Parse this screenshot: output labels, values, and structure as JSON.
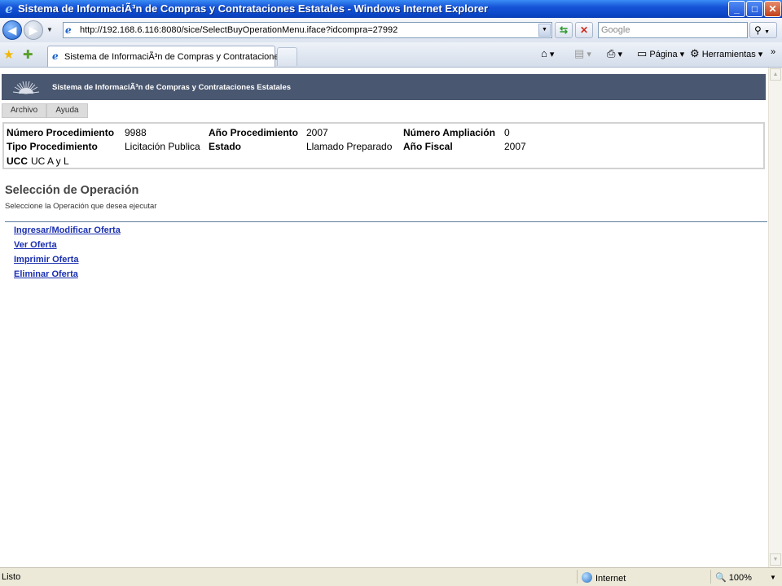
{
  "window": {
    "title": "Sistema de InformaciÃ³n de Compras y Contrataciones Estatales - Windows Internet Explorer",
    "minimize": "_",
    "maximize": "□",
    "close": "✕"
  },
  "navbar": {
    "url": "http://192.168.6.116:8080/sice/SelectBuyOperationMenu.iface?idcompra=27992",
    "search_placeholder": "Google"
  },
  "tabs": [
    {
      "label": "Sistema de InformaciÃ³n de Compras y Contratacione..."
    }
  ],
  "toolbar": {
    "page_label": "Página",
    "tools_label": "Herramientas"
  },
  "app": {
    "title": "Sistema de InformaciÃ³n de Compras y Contrataciones Estatales",
    "menu": [
      "Archivo",
      "Ayuda"
    ]
  },
  "info": {
    "numero_procedimiento_label": "Número Procedimiento",
    "numero_procedimiento_value": "9988",
    "anio_procedimiento_label": "Año Procedimiento",
    "anio_procedimiento_value": "2007",
    "numero_ampliacion_label": "Número Ampliación",
    "numero_ampliacion_value": "0",
    "tipo_procedimiento_label": "Tipo Procedimiento",
    "tipo_procedimiento_value": "Licitación Publica",
    "estado_label": "Estado",
    "estado_value": "Llamado Preparado",
    "anio_fiscal_label": "Año Fiscal",
    "anio_fiscal_value": "2007",
    "ucc_label": "UCC",
    "ucc_value": "UC A y L"
  },
  "section": {
    "title": "Selección de Operación",
    "subtitle": "Seleccione la Operación que desea ejecutar"
  },
  "operations": [
    "Ingresar/Modificar Oferta",
    "Ver Oferta",
    "Imprimir Oferta",
    "Eliminar Oferta"
  ],
  "status": {
    "left": "Listo",
    "zone": "Internet",
    "zoom": "100%"
  }
}
